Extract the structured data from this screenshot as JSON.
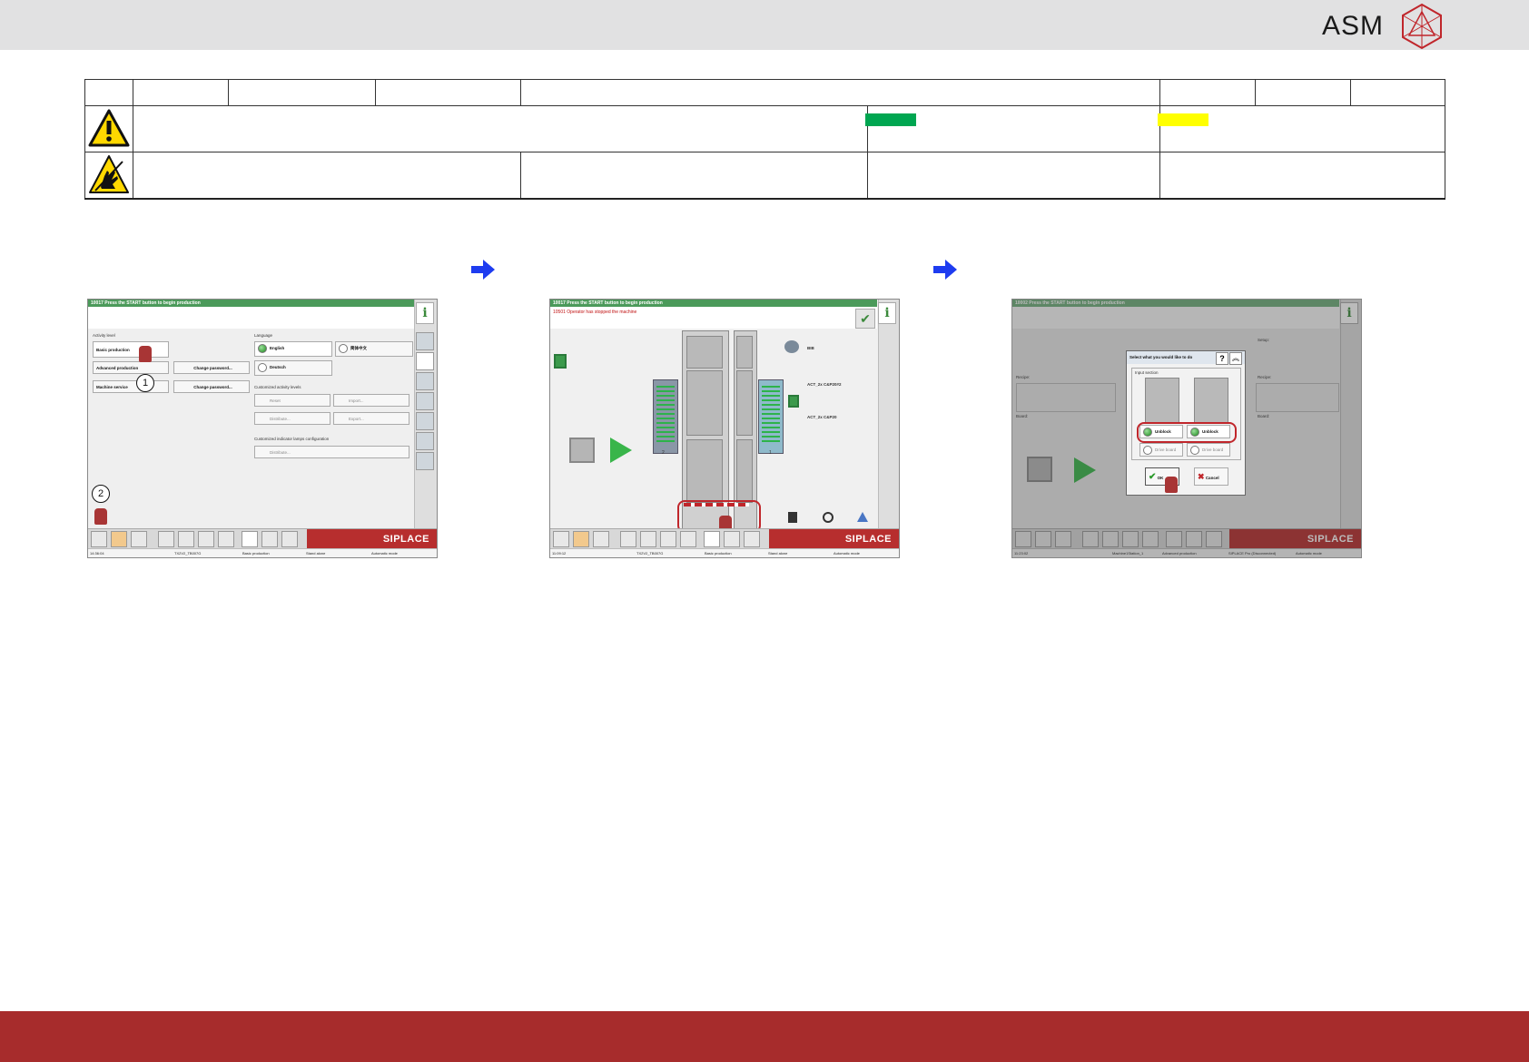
{
  "brand": {
    "name": "ASM",
    "footer_color": "#a72c2c",
    "header_color": "#e1e1e2"
  },
  "safety_table": {
    "warning_icon": "warning-triangle-icon",
    "esd_icon": "esd-hand-icon",
    "swatches": {
      "green": "#00a651",
      "yellow": "#ffff00"
    }
  },
  "flow": {
    "arrow_icon": "blue-arrow-right-icon",
    "arrow_color": "#1e3cf0"
  },
  "screen1": {
    "title": "10017 Press the START button to begin production",
    "activity_heading": "Activity level",
    "language_heading": "Language",
    "buttons": {
      "basic": "Basic production",
      "advanced": "Advanced production",
      "service": "Machine service",
      "change1": "Change password...",
      "change2": "Change password..."
    },
    "languages": {
      "english": "English",
      "chinese": "简体中文",
      "german": "Deutsch"
    },
    "customized_heading": "Customized activity levels",
    "customized": {
      "reset": "Reset",
      "import": "Import...",
      "distribute": "Distribute...",
      "export": "Export..."
    },
    "indicator_heading": "Customized indicator lamps configuration",
    "indicator_distribute": "Distribute...",
    "callout1": "1",
    "callout2": "2",
    "siplace": "SIPLACE",
    "status": {
      "time": "14:36:04",
      "machine": "TX2V2_TB007G",
      "level": "Basic production",
      "mode": "Stand alone",
      "auto": "Automatic mode"
    }
  },
  "screen2": {
    "title": "10017 Press the START button to begin production",
    "message": "10501 Operator has stopped the machine",
    "labels": {
      "l1": "BIB",
      "l2": "ACT_2x C&P20#2",
      "l3": "ACT_2x C&P20"
    },
    "lcd_labels": {
      "left": "2",
      "right": "1"
    },
    "siplace": "SIPLACE",
    "status": {
      "time": "11:09:12",
      "machine": "TX2V2_TB007G",
      "level": "Basic production",
      "mode": "Stand alone",
      "auto": "Automatic mode"
    }
  },
  "screen3": {
    "title": "10002 Press the START button to begin production",
    "labels": {
      "setup": "Setup:",
      "recipe_l": "Recipe:",
      "board_l": "Board:",
      "recipe_r": "Recipe:",
      "board_r": "Board:"
    },
    "dialog": {
      "title": "Select what you would like to do",
      "section": "Input section",
      "unblock1": "Unblock",
      "unblock2": "Unblock",
      "drive1": "Drive board",
      "drive2": "Drive board",
      "ok": "OK",
      "cancel": "Cancel"
    },
    "siplace": "SIPLACE",
    "status": {
      "time": "11:23:02",
      "machine": "Machine1Station_1",
      "level": "Advanced production",
      "pro": "SIPLACE Pro (Disconnected)",
      "auto": "Automatic mode"
    }
  }
}
